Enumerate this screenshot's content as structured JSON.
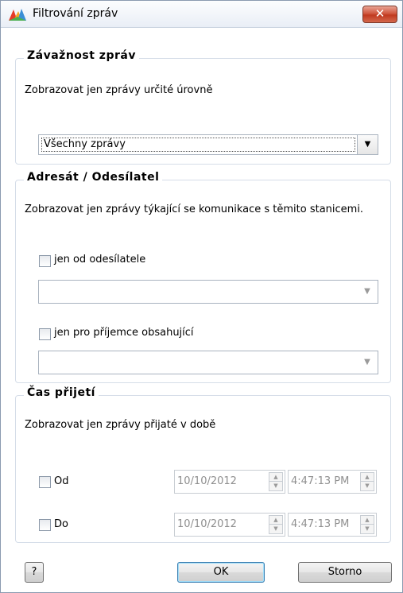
{
  "window": {
    "title": "Filtrování zpráv",
    "close_label": "✕"
  },
  "severity": {
    "heading": "Závažnost zpráv",
    "description": "Zobrazovat jen zprávy určité úrovně",
    "selected": "Všechny zprávy"
  },
  "recipient": {
    "heading": "Adresát / Odesílatel",
    "description": "Zobrazovat jen zprávy týkající se komunikace s těmito stanicemi.",
    "sender_label": "jen od odesílatele",
    "sender_value": "",
    "receiver_label": "jen pro příjemce obsahující",
    "receiver_value": ""
  },
  "time": {
    "heading": "Čas přijetí",
    "description": "Zobrazovat jen zprávy přijaté v době",
    "from_label": "Od",
    "from_date": "10/10/2012",
    "from_time": "4:47:13 PM",
    "to_label": "Do",
    "to_date": "10/10/2012",
    "to_time": "4:47:13 PM"
  },
  "buttons": {
    "help": "?",
    "ok": "OK",
    "cancel": "Storno"
  },
  "colors": {
    "close_red": "#c0391f",
    "group_border": "#d5dde8",
    "default_button_border": "#3c7fb1"
  }
}
